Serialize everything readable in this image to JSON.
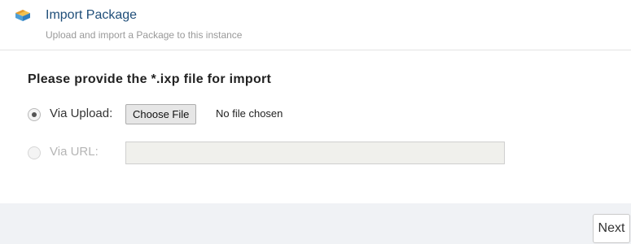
{
  "header": {
    "title": "Import Package",
    "subtitle": "Upload and import a Package to this instance",
    "icon": "package-box-icon"
  },
  "form": {
    "section_title": "Please provide the *.ixp file for import",
    "upload_option": {
      "label": "Via Upload:",
      "selected": true,
      "button_label": "Choose File",
      "file_status": "No file chosen"
    },
    "url_option": {
      "label": "Via URL:",
      "selected": false,
      "disabled": true,
      "value": "",
      "placeholder": ""
    }
  },
  "footer": {
    "next_label": "Next"
  },
  "colors": {
    "title_blue": "#1f4e79",
    "footer_bg": "#f0f2f5"
  }
}
